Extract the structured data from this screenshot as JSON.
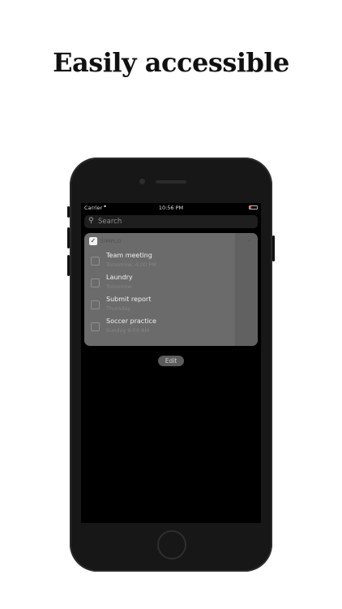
{
  "headline": "Easily accessible",
  "status_bar": {
    "carrier": "Carrier",
    "time": "10:56 PM",
    "battery_level": 0.25
  },
  "search": {
    "placeholder": "Search"
  },
  "widget": {
    "app_name": "SIMPLO",
    "tasks": [
      {
        "title": "Team meeting",
        "subtitle": "Tomorrow, 4:00 PM"
      },
      {
        "title": "Laundry",
        "subtitle": "Tomorrow"
      },
      {
        "title": "Submit report",
        "subtitle": "Thursday"
      },
      {
        "title": "Soccer practice",
        "subtitle": "Sunday 9:00 AM"
      }
    ]
  },
  "edit_label": "Edit",
  "colors": {
    "accent": "#ff3b30",
    "widget_bg": "#6b6b6b",
    "screen_bg": "#000000"
  },
  "icons": {
    "wifi": "wifi-icon",
    "search": "search-icon",
    "check": "check-icon",
    "chevron": "chevron-down-icon"
  }
}
